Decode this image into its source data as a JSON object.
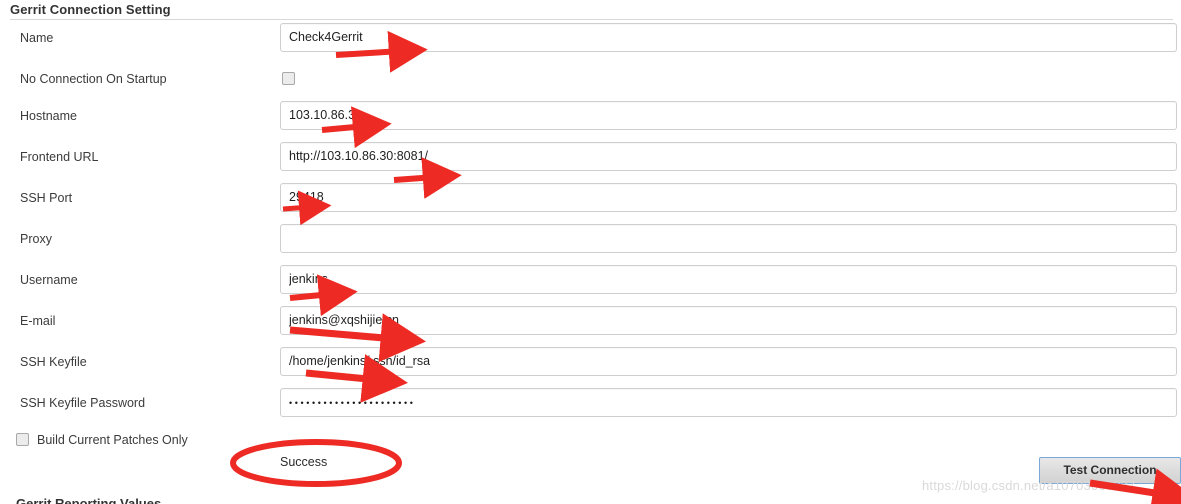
{
  "section": {
    "title": "Gerrit Connection Setting"
  },
  "fields": [
    {
      "label": "Name",
      "value": "Check4Gerrit",
      "type": "text"
    },
    {
      "label": "No Connection On Startup",
      "value": "",
      "type": "checkbox",
      "checked": false
    },
    {
      "label": "Hostname",
      "value": "103.10.86.30",
      "type": "text"
    },
    {
      "label": "Frontend URL",
      "value": "http://103.10.86.30:8081/",
      "type": "text"
    },
    {
      "label": "SSH Port",
      "value": "29418",
      "type": "text"
    },
    {
      "label": "Proxy",
      "value": "",
      "type": "text"
    },
    {
      "label": "Username",
      "value": "jenkins",
      "type": "text"
    },
    {
      "label": "E-mail",
      "value": "jenkins@xqshijie.cn",
      "type": "text"
    },
    {
      "label": "SSH Keyfile",
      "value": "/home/jenkins/.ssh/id_rsa",
      "type": "text"
    },
    {
      "label": "SSH Keyfile Password",
      "value": "••••••••••••••••••••••",
      "type": "password"
    }
  ],
  "bottom": {
    "build_current_patches_label": "Build Current Patches Only",
    "build_current_patches_checked": false,
    "status_text": "Success",
    "test_connection_label": "Test Connection",
    "next_section_title": "Gerrit Reporting Values"
  },
  "watermark": {
    "text": "https://blog.csdn.net/a10703060237"
  },
  "colors": {
    "annotation_red": "#ee2a24",
    "field_border": "#cfcfcf",
    "button_border": "#7aa7d8",
    "text": "#333333"
  },
  "annotations": {
    "note": "red arrows point at filled values; red ellipse highlights the Success status"
  }
}
